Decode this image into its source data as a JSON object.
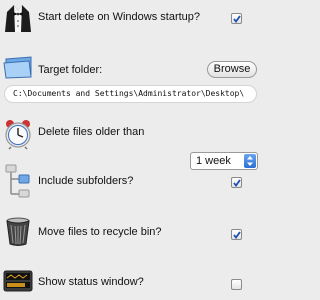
{
  "options": {
    "startup": {
      "label": "Start delete on Windows startup?",
      "checked": true
    },
    "target_folder": {
      "label": "Target folder:",
      "browse_label": "Browse",
      "path": "C:\\Documents and Settings\\Administrator\\Desktop\\"
    },
    "age": {
      "label": "Delete files older than",
      "selected": "1 week"
    },
    "subfolders": {
      "label": "Include subfolders?",
      "checked": true
    },
    "recycle": {
      "label": "Move files to recycle bin?",
      "checked": true
    },
    "status_window": {
      "label": "Show status window?",
      "checked": false
    }
  },
  "icons": {
    "startup": "tuxedo-icon",
    "target_folder": "folder-icon",
    "age": "clock-icon",
    "subfolders": "folder-tree-icon",
    "recycle": "trash-bin-icon",
    "status_window": "status-display-icon"
  },
  "colors": {
    "background": "#ececec",
    "check": "#1f4fb0",
    "stepper": "#2a6fd4"
  }
}
